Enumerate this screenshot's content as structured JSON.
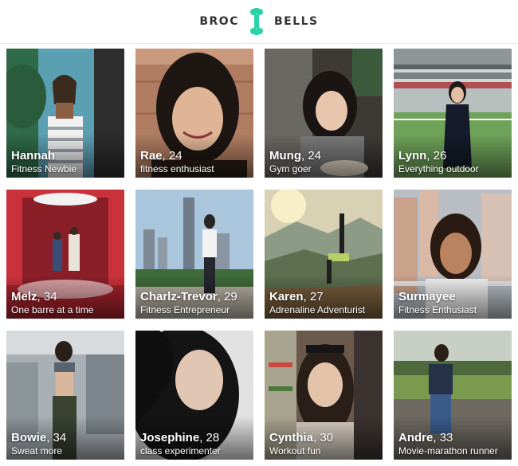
{
  "brand": {
    "left": "BROC",
    "right": "BELLS",
    "logo_icon": "broccoli-dumbbell-icon",
    "accent": "#2bd1a8"
  },
  "profiles": [
    {
      "name": "Hannah",
      "age": "",
      "tagline": "Fitness Newbie"
    },
    {
      "name": "Rae",
      "age": "24",
      "tagline": "fitness enthusiast"
    },
    {
      "name": "Mung",
      "age": "24",
      "tagline": "Gym goer"
    },
    {
      "name": "Lynn",
      "age": "26",
      "tagline": "Everything outdoor"
    },
    {
      "name": "Melz",
      "age": "34",
      "tagline": "One barre at a time"
    },
    {
      "name": "Charlz-Trevor",
      "age": "29",
      "tagline": "Fitness Entrepreneur"
    },
    {
      "name": "Karen",
      "age": "27",
      "tagline": "Adrenaline Adventurist"
    },
    {
      "name": "Surmayee",
      "age": "",
      "tagline": "Fitness Enthusiast"
    },
    {
      "name": "Bowie",
      "age": "34",
      "tagline": "Sweat more"
    },
    {
      "name": "Josephine",
      "age": "28",
      "tagline": "class experimenter"
    },
    {
      "name": "Cynthia",
      "age": "30",
      "tagline": "Workout fun"
    },
    {
      "name": "Andre",
      "age": "33",
      "tagline": "Movie-marathon runner"
    }
  ]
}
